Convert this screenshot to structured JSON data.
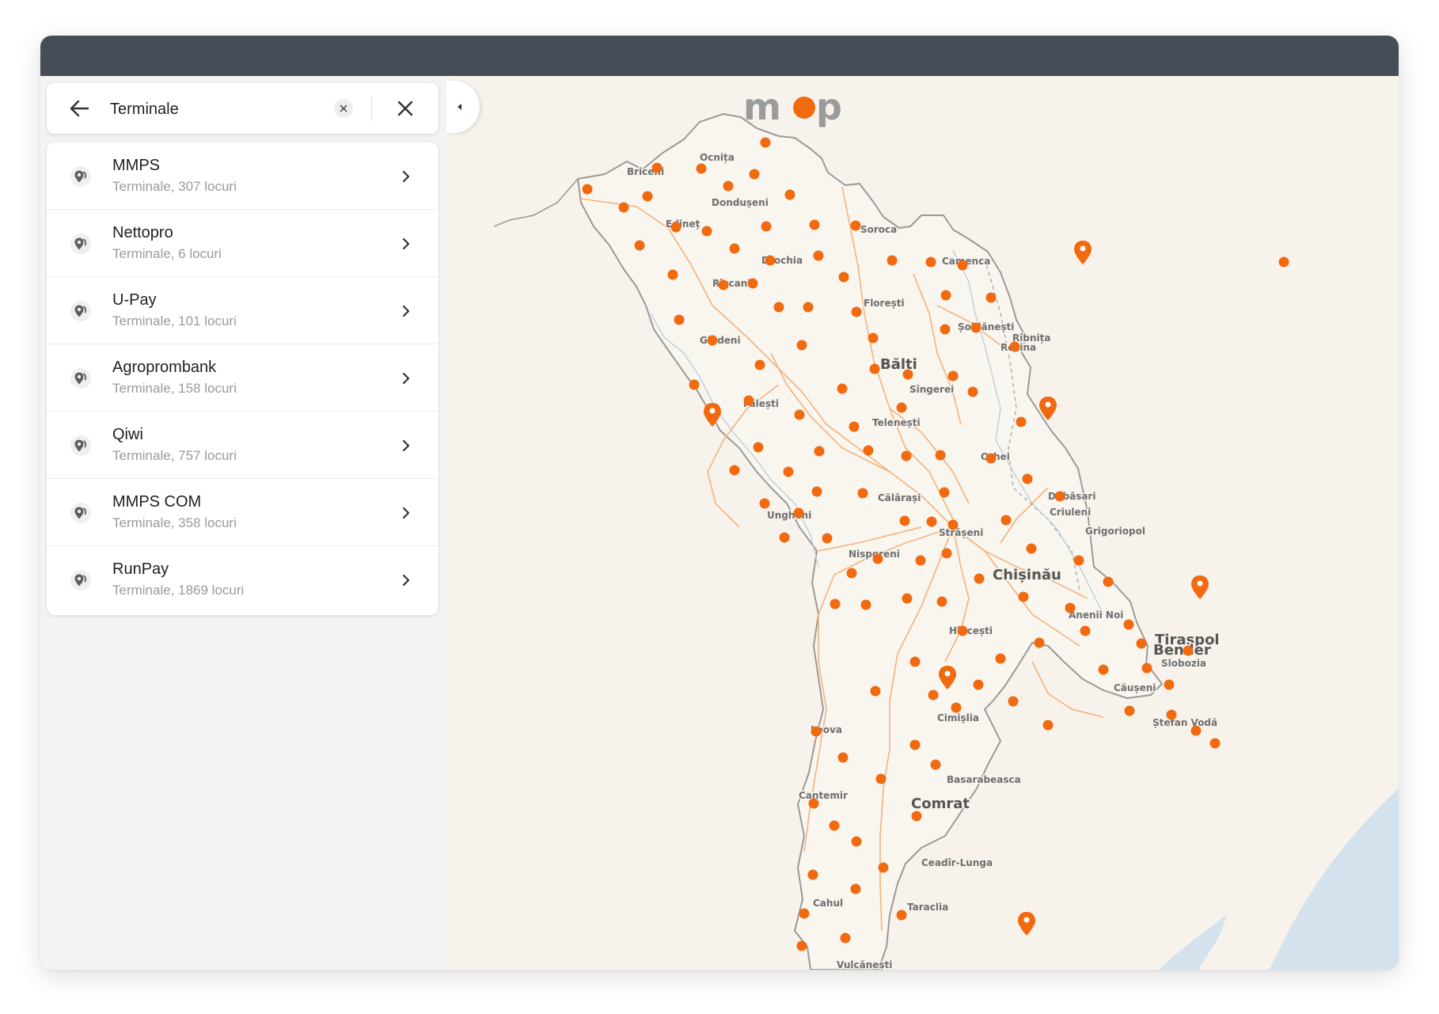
{
  "search": {
    "value": "Terminale",
    "back_icon": "arrow-left-icon",
    "clear_icon": "clear-icon",
    "close_icon": "close-icon"
  },
  "results": [
    {
      "name": "MMPS",
      "meta": "Terminale, 307 locuri"
    },
    {
      "name": "Nettopro",
      "meta": "Terminale, 6 locuri"
    },
    {
      "name": "U-Pay",
      "meta": "Terminale, 101 locuri"
    },
    {
      "name": "Agroprombank",
      "meta": "Terminale, 158 locuri"
    },
    {
      "name": "Qiwi",
      "meta": "Terminale, 757 locuri"
    },
    {
      "name": "MMPS COM",
      "meta": "Terminale, 358 locuri"
    },
    {
      "name": "RunPay",
      "meta": "Terminale, 1869 locuri"
    }
  ],
  "map": {
    "logo": "map",
    "cities": {
      "ocnita": "Ocnița",
      "briceni": "Briceni",
      "donduseni": "Dondușeni",
      "edinet": "Edineț",
      "soroca": "Soroca",
      "drochia": "Drochia",
      "camenca": "Camenca",
      "riscani": "Rîșcani",
      "floresti": "Florești",
      "soldanesti": "Șoldănești",
      "ribnita": "Rîbnița",
      "rezina": "Rezina",
      "glodeni": "Glodeni",
      "balti": "Bălți",
      "singerei": "Sîngerei",
      "falesti": "Fălești",
      "telenesti": "Telenești",
      "orhei": "Orhei",
      "dubasari": "Dubăsari",
      "criuleni": "Criuleni",
      "grigoriopol": "Grigoriopol",
      "calarasi": "Călărași",
      "ungheni": "Ungheni",
      "straseni": "Strășeni",
      "nisporeni": "Nisporeni",
      "chisinau": "Chișinău",
      "anenii_noi": "Anenii Noi",
      "tiraspol": "Tiraspol",
      "bender": "Bender",
      "slobozia": "Slobozia",
      "hincesti": "Hîncești",
      "causeni": "Căușeni",
      "leova": "Leova",
      "cimislia": "Cimișlia",
      "stefan_voda": "Ștefan Vodă",
      "basarabeasca": "Basarabeasca",
      "cantemir": "Cantemir",
      "comrat": "Comrat",
      "ceadir_lunga": "Ceadîr-Lunga",
      "cahul": "Cahul",
      "taraclia": "Taraclia",
      "vulcanesti": "Vulcănești"
    },
    "colors": {
      "marker": "#f26a10",
      "road": "#f5b27a",
      "border": "#9a9a9a",
      "water": "#d3e2ec",
      "land": "#f7f3ec",
      "outside_land": "#f1ece3"
    }
  }
}
